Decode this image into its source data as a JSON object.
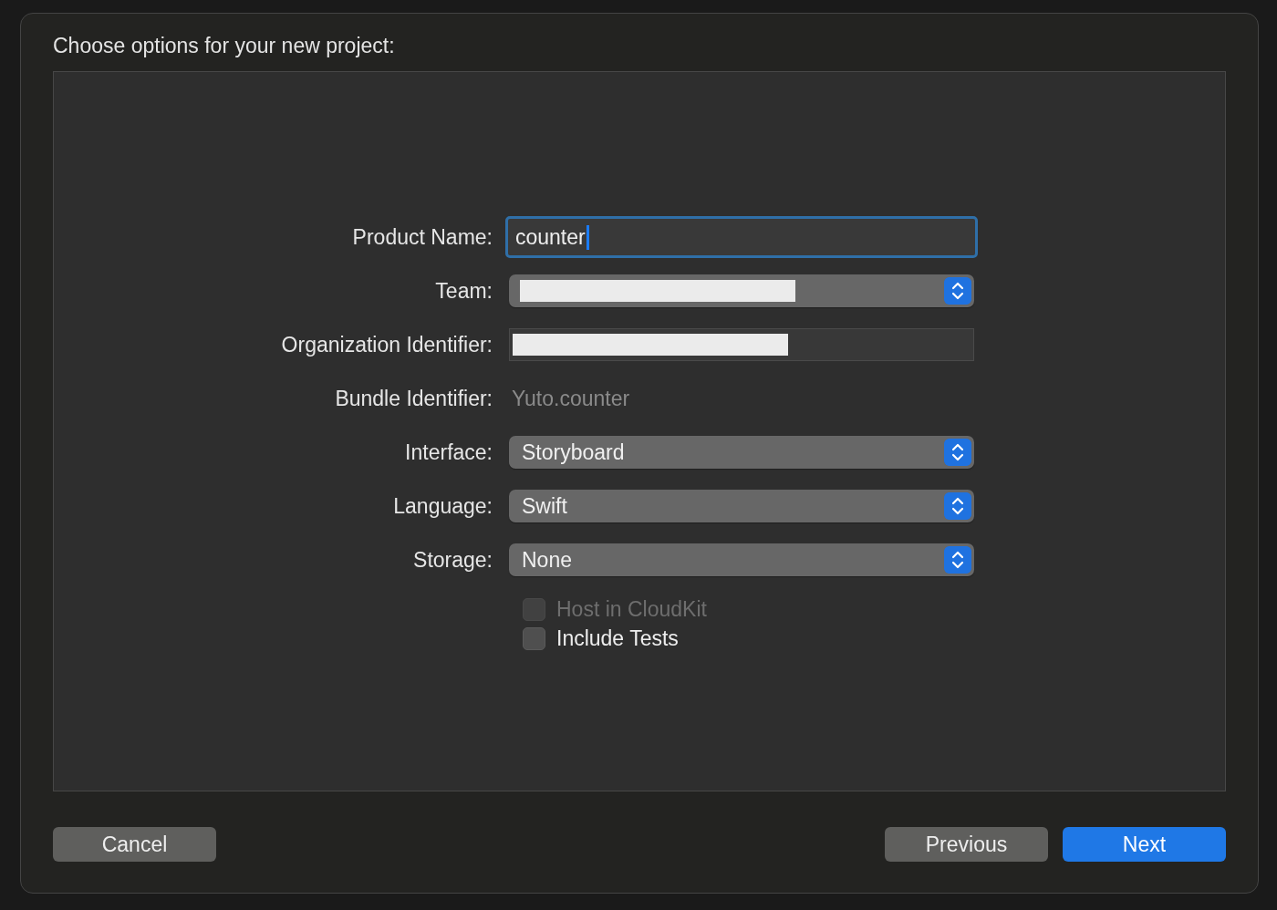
{
  "dialog": {
    "title": "Choose options for your new project:"
  },
  "fields": [
    {
      "label": "Product Name:",
      "kind": "text",
      "value": "counter",
      "focused": true
    },
    {
      "label": "Team:",
      "kind": "popup-redacted"
    },
    {
      "label": "Organization Identifier:",
      "kind": "text-redacted"
    },
    {
      "label": "Bundle Identifier:",
      "kind": "static",
      "value": "Yuto.counter"
    },
    {
      "label": "Interface:",
      "kind": "popup",
      "value": "Storyboard"
    },
    {
      "label": "Language:",
      "kind": "popup",
      "value": "Swift"
    },
    {
      "label": "Storage:",
      "kind": "popup",
      "value": "None"
    }
  ],
  "checkboxes": [
    {
      "label": "Host in CloudKit",
      "checked": false,
      "disabled": true
    },
    {
      "label": "Include Tests",
      "checked": false,
      "disabled": false
    }
  ],
  "buttons": [
    {
      "label": "Cancel",
      "kind": "normal"
    },
    {
      "label": "Previous",
      "kind": "normal"
    },
    {
      "label": "Next",
      "kind": "default"
    }
  ]
}
